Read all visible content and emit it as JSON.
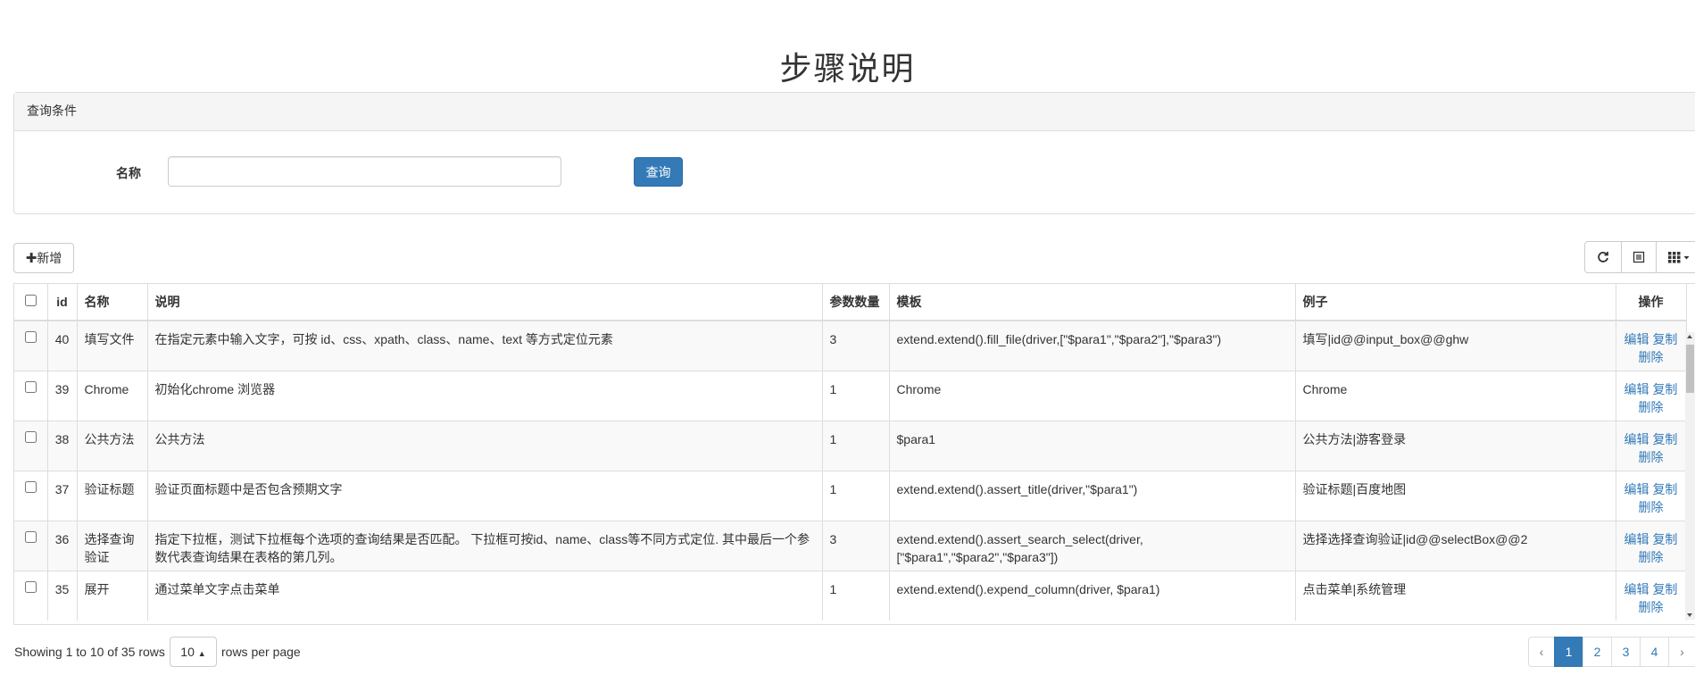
{
  "page": {
    "title": "步骤说明"
  },
  "search_panel": {
    "heading": "查询条件",
    "name_label": "名称",
    "name_value": "",
    "query_button": "查询"
  },
  "toolbar": {
    "add_button": "新增",
    "add_icon": "plus-icon",
    "refresh_icon": "refresh-icon",
    "toggle_view_icon": "list-view-icon",
    "columns_icon": "grid-columns-icon"
  },
  "table": {
    "columns": [
      "id",
      "名称",
      "说明",
      "参数数量",
      "模板",
      "例子",
      "操作"
    ],
    "rows": [
      {
        "id": "40",
        "name": "填写文件",
        "desc": "在指定元素中输入文字，可按 id、css、xpath、class、name、text 等方式定位元素",
        "param_count": "3",
        "template": "extend.extend().fill_file(driver,[\"$para1\",\"$para2\"],\"$para3\")",
        "example": "填写|id@@input_box@@ghw"
      },
      {
        "id": "39",
        "name": "Chrome",
        "desc": "初始化chrome 浏览器",
        "param_count": "1",
        "template": "Chrome",
        "example": "Chrome"
      },
      {
        "id": "38",
        "name": "公共方法",
        "desc": "公共方法",
        "param_count": "1",
        "template": "$para1",
        "example": "公共方法|游客登录"
      },
      {
        "id": "37",
        "name": "验证标题",
        "desc": "验证页面标题中是否包含预期文字",
        "param_count": "1",
        "template": "extend.extend().assert_title(driver,\"$para1\")",
        "example": "验证标题|百度地图"
      },
      {
        "id": "36",
        "name": "选择查询验证",
        "desc": "指定下拉框，测试下拉框每个选项的查询结果是否匹配。 下拉框可按id、name、class等不同方式定位. 其中最后一个参数代表查询结果在表格的第几列。",
        "param_count": "3",
        "template": "extend.extend().assert_search_select(driver,[\"$para1\",\"$para2\",\"$para3\"])",
        "example": "选择选择查询验证|id@@selectBox@@2"
      },
      {
        "id": "35",
        "name": "展开",
        "desc": "通过菜单文字点击菜单",
        "param_count": "1",
        "template": "extend.extend().expend_column(driver, $para1)",
        "example": "点击菜单|系统管理"
      }
    ],
    "ops": {
      "edit": "编辑",
      "copy": "复制",
      "delete": "删除"
    }
  },
  "footer": {
    "showing_text": "Showing 1 to 10 of 35 rows",
    "page_size": "10",
    "rows_per_page": "rows per page"
  },
  "pagination": {
    "prev": "‹",
    "pages": [
      "1",
      "2",
      "3",
      "4"
    ],
    "next": "›",
    "active_page": "1"
  },
  "colors": {
    "primary": "#337ab7",
    "border": "#dddddd",
    "stripe": "#f9f9f9"
  }
}
